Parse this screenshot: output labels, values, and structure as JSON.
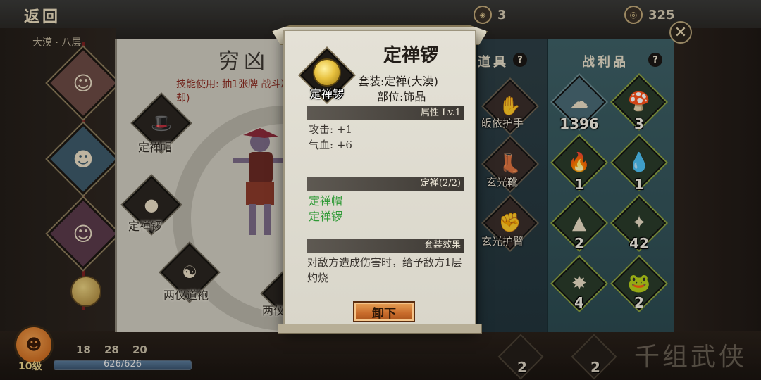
{
  "top_bar": {
    "back_label": "返回",
    "floor_label": "大漠 · 八层",
    "currency_a": {
      "icon": "token-icon",
      "value": "3"
    },
    "currency_b": {
      "icon": "coin-icon",
      "value": "325"
    }
  },
  "player": {
    "level": "10级",
    "hp": "626/626",
    "hp_fraction": 1.0,
    "stats": [
      "18",
      "28",
      "20"
    ]
  },
  "equip_panel": {
    "title": "穷凶",
    "skill_text": "技能使用: 抽1张牌 战斗冷却)",
    "slots": [
      {
        "label": "定禅帽",
        "icon": "hat-icon"
      },
      {
        "label": "定禅锣",
        "icon": "gong-icon"
      },
      {
        "label": "两仪道袍",
        "icon": "robe-icon"
      },
      {
        "label": "两仪",
        "icon": "item-icon"
      }
    ]
  },
  "items_panel": {
    "heading": "道具",
    "items": [
      {
        "label": "皈依护手",
        "icon": "bracer-icon"
      },
      {
        "label": "玄光靴",
        "icon": "boots-icon"
      },
      {
        "label": "玄光护臂",
        "icon": "armguard-icon"
      }
    ]
  },
  "loot_panel": {
    "heading": "战利品",
    "items": [
      {
        "count": "1396",
        "icon": "cloud-material-icon"
      },
      {
        "count": "3",
        "icon": "mushroom-icon"
      },
      {
        "count": "1",
        "icon": "fire-orb-icon"
      },
      {
        "count": "1",
        "icon": "water-orb-icon"
      },
      {
        "count": "2",
        "icon": "straw-hat-icon"
      },
      {
        "count": "42",
        "icon": "purple-flame-icon"
      },
      {
        "count": "4",
        "icon": "firework-icon"
      },
      {
        "count": "2",
        "icon": "jade-frog-icon"
      }
    ]
  },
  "bottom_slots": [
    "2",
    "2"
  ],
  "deco_text": "千组武侠",
  "popup": {
    "title": "定禅锣",
    "icon_label": "定禅锣",
    "set_line": "套装:定禅(大漠)",
    "part_line": "部位:饰品",
    "attr_header": "属性 Lv.1",
    "attrs": [
      "攻击: +1",
      "气血: +6"
    ],
    "set_header": "定禅(2/2)",
    "set_pieces": [
      "定禅帽",
      "定禅锣"
    ],
    "effect_header": "套装效果",
    "effect_text": "对敌方造成伤害时，给予敌方1层灼烧",
    "unequip_label": "卸下"
  },
  "colors": {
    "set_piece_green": "#2f9a36",
    "button_orange": "#c76a2a",
    "loot_panel_teal": "#3e6066"
  }
}
